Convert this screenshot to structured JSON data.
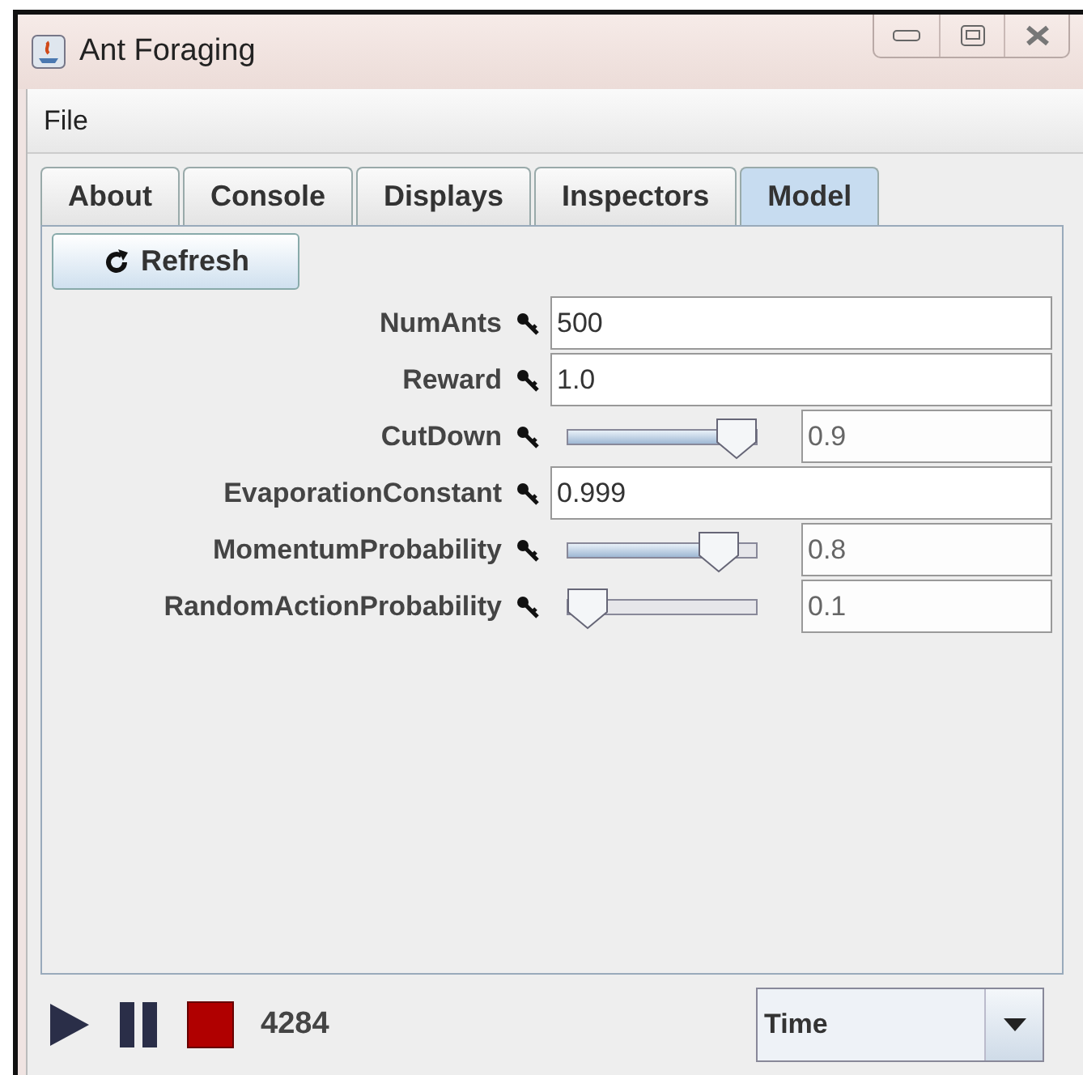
{
  "window": {
    "title": "Ant Foraging"
  },
  "menu": [
    "File"
  ],
  "tabs": [
    {
      "label": "About",
      "selected": false
    },
    {
      "label": "Console",
      "selected": false
    },
    {
      "label": "Displays",
      "selected": false
    },
    {
      "label": "Inspectors",
      "selected": false
    },
    {
      "label": "Model",
      "selected": true
    }
  ],
  "refresh_button": "Refresh",
  "properties": [
    {
      "name": "NumAnts",
      "kind": "text",
      "value": "500"
    },
    {
      "name": "Reward",
      "kind": "text",
      "value": "1.0"
    },
    {
      "name": "CutDown",
      "kind": "slider",
      "level": 0.9,
      "value": "0.9"
    },
    {
      "name": "EvaporationConstant",
      "kind": "text",
      "value": "0.999"
    },
    {
      "name": "MomentumProbability",
      "kind": "slider",
      "level": 0.8,
      "value": "0.8"
    },
    {
      "name": "RandomActionProbability",
      "kind": "slider",
      "level": 0.1,
      "value": "0.1"
    }
  ],
  "status_bar": {
    "steps": "4284",
    "time_mode": "Time"
  }
}
